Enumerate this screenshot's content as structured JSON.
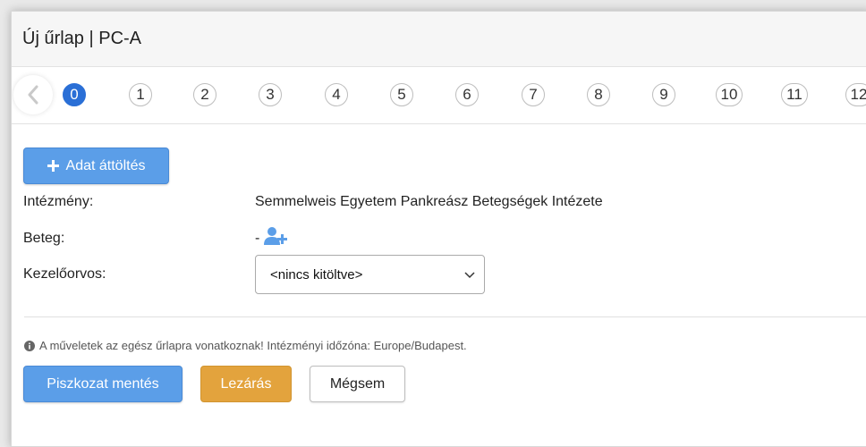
{
  "header": {
    "title": "Új űrlap | PC-A"
  },
  "steps": {
    "items": [
      "0",
      "1",
      "2",
      "3",
      "4",
      "5",
      "6",
      "7",
      "8",
      "9",
      "10",
      "11",
      "12"
    ],
    "active_index": 0
  },
  "toolbar": {
    "add_label": "Adat áttöltés"
  },
  "fields": {
    "institution": {
      "label": "Intézmény:",
      "value": "Semmelweis Egyetem Pankreász Betegségek Intézete"
    },
    "patient": {
      "label": "Beteg:",
      "value": "-"
    },
    "doctor": {
      "label": "Kezelőorvos:",
      "selected": "<nincs kitöltve>"
    }
  },
  "info": {
    "text": "A műveletek az egész űrlapra vonatkoznak! Intézményi időzóna: Europe/Budapest."
  },
  "actions": {
    "draft_label": "Piszkozat mentés",
    "close_label": "Lezárás",
    "cancel_label": "Mégsem"
  },
  "colors": {
    "accent": "#2a6fd6",
    "primary_button": "#5b9ee8",
    "warning_button": "#e3a33d"
  }
}
